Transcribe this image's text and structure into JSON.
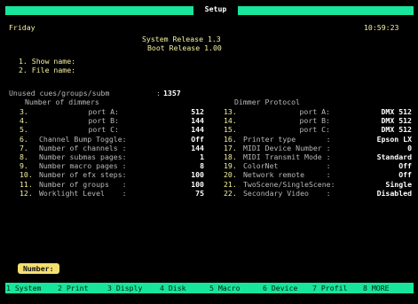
{
  "titlebar": {
    "title": "Setup"
  },
  "header": {
    "day": "Friday",
    "time": "10:59:23"
  },
  "release": {
    "system": "System Release 1.3",
    "boot": "Boot Release 1.00"
  },
  "fields": {
    "show_label": "1. Show name:",
    "file_label": "2. File name:"
  },
  "unused": {
    "label": "Unused cues/groups/subm",
    "sep": ":",
    "value": "1357"
  },
  "dimmers": {
    "heading": "Number of dimmers"
  },
  "dimmer_protocol": {
    "heading": "Dimmer Protocol"
  },
  "left_rows": [
    {
      "num": "3.",
      "label": "port A:",
      "value": "512"
    },
    {
      "num": "4.",
      "label": "port B:",
      "value": "144"
    },
    {
      "num": "5.",
      "label": "port C:",
      "value": "144"
    },
    {
      "num": "6.",
      "label": "Channel Bump Toggle:",
      "value": "Off"
    },
    {
      "num": "7.",
      "label": "Number of channels :",
      "value": "144"
    },
    {
      "num": "8.",
      "label": "Number submas pages:",
      "value": "1"
    },
    {
      "num": "9.",
      "label": "Number macro pages :",
      "value": "8"
    },
    {
      "num": "10.",
      "label": "Number of efx steps:",
      "value": "100"
    },
    {
      "num": "11.",
      "label": "Number of groups   :",
      "value": "100"
    },
    {
      "num": "12.",
      "label": "Worklight Level    :",
      "value": "75"
    }
  ],
  "right_rows": [
    {
      "num": "13.",
      "label": "port A:",
      "value": "DMX 512"
    },
    {
      "num": "14.",
      "label": "port B:",
      "value": "DMX 512"
    },
    {
      "num": "15.",
      "label": "port C:",
      "value": "DMX 512"
    },
    {
      "num": "16.",
      "label": "Printer type       :",
      "value": "Epson LX"
    },
    {
      "num": "17.",
      "label": "MIDI Device Number :",
      "value": "0"
    },
    {
      "num": "18.",
      "label": "MIDI Transmit Mode :",
      "value": "Standard"
    },
    {
      "num": "19.",
      "label": "ColorNet           :",
      "value": "Off"
    },
    {
      "num": "20.",
      "label": "Network remote     :",
      "value": "Off"
    },
    {
      "num": "21.",
      "label": "TwoScene/SingleScene:",
      "value": "Single"
    },
    {
      "num": "22.",
      "label": "Secondary Video    :",
      "value": "Disabled"
    }
  ],
  "prompt": {
    "label": "Number:"
  },
  "fkeys": [
    {
      "num": "1",
      "label": "System"
    },
    {
      "num": "2",
      "label": "Print"
    },
    {
      "num": "3",
      "label": "Disply"
    },
    {
      "num": "4",
      "label": "Disk"
    },
    {
      "num": "5",
      "label": "Macro"
    },
    {
      "num": "6",
      "label": "Device"
    },
    {
      "num": "7",
      "label": "Profil"
    },
    {
      "num": "8",
      "label": "MORE"
    }
  ],
  "colors": {
    "accent": "#17e69c",
    "prompt": "#f4df6e",
    "numbers": "#f6f0a0"
  }
}
